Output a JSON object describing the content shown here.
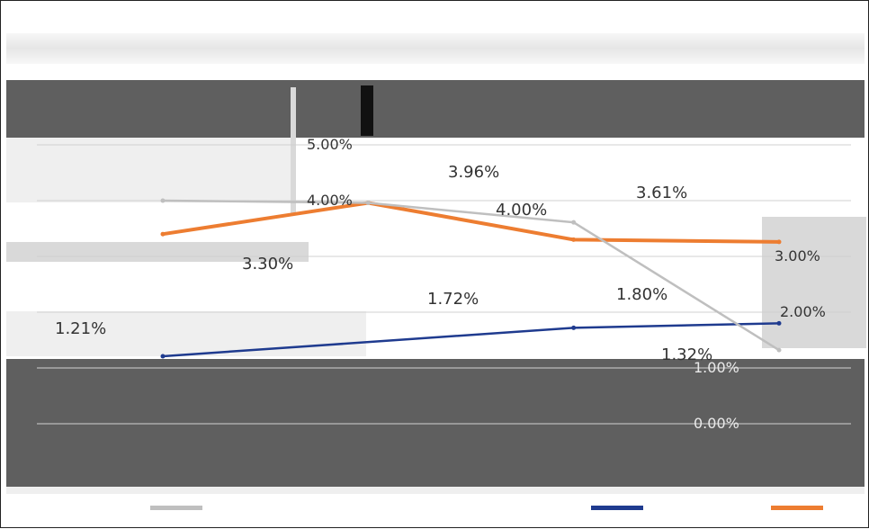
{
  "chart_data": {
    "type": "line",
    "title": "",
    "xlabel": "",
    "ylabel": "",
    "ylim": [
      0,
      5
    ],
    "y_axis_ticks": [
      "5.00%",
      "4.00%",
      "3.00%",
      "2.00%",
      "1.00%",
      "0.00%"
    ],
    "categories": [
      "",
      "",
      "",
      ""
    ],
    "series": [
      {
        "name": "",
        "color": "#1f3b8f",
        "values": [
          1.21,
          null,
          1.72,
          1.8
        ]
      },
      {
        "name": "",
        "color": "#ed7d31",
        "values": [
          3.4,
          3.96,
          3.3,
          3.26
        ]
      },
      {
        "name": "",
        "color": "#bfbfbf",
        "values": [
          4.0,
          3.96,
          3.61,
          1.32
        ]
      }
    ],
    "data_labels": [
      "1.21%",
      "3.96%",
      "3.61%",
      "3.30%",
      "1.72%",
      "1.80%",
      "1.32%",
      "4.00%"
    ],
    "legend_position": "bottom",
    "grid": true
  }
}
